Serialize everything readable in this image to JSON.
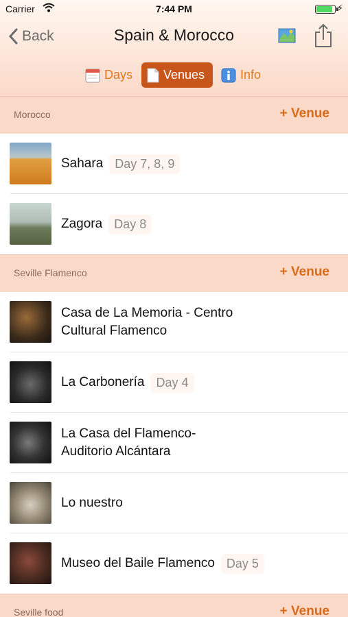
{
  "status_bar": {
    "carrier": "Carrier",
    "time": "7:44 PM"
  },
  "nav": {
    "back_label": "Back",
    "title": "Spain & Morocco"
  },
  "segments": {
    "days": "Days",
    "venues": "Venues",
    "info": "Info",
    "selected": "Venues"
  },
  "sections": [
    {
      "name": "Morocco",
      "add_label": "+ Venue",
      "venues": [
        {
          "name": "Sahara",
          "days": "Day 7, 8, 9"
        },
        {
          "name": "Zagora",
          "days": "Day 8"
        }
      ]
    },
    {
      "name": "Seville Flamenco",
      "add_label": "+ Venue",
      "venues": [
        {
          "name": "Casa de La Memoria - Centro Cultural Flamenco",
          "days": ""
        },
        {
          "name": "La Carbonería",
          "days": "Day 4"
        },
        {
          "name": "La Casa del Flamenco-Auditorio Alcántara",
          "days": ""
        },
        {
          "name": "Lo nuestro",
          "days": ""
        },
        {
          "name": "Museo del Baile Flamenco",
          "days": "Day 5"
        }
      ]
    },
    {
      "name": "Seville food",
      "add_label": "+ Venue",
      "venues": []
    }
  ],
  "colors": {
    "accent": "#e07a1f",
    "selected_segment": "#c8551a",
    "section_bg": "#fbd9c9"
  }
}
